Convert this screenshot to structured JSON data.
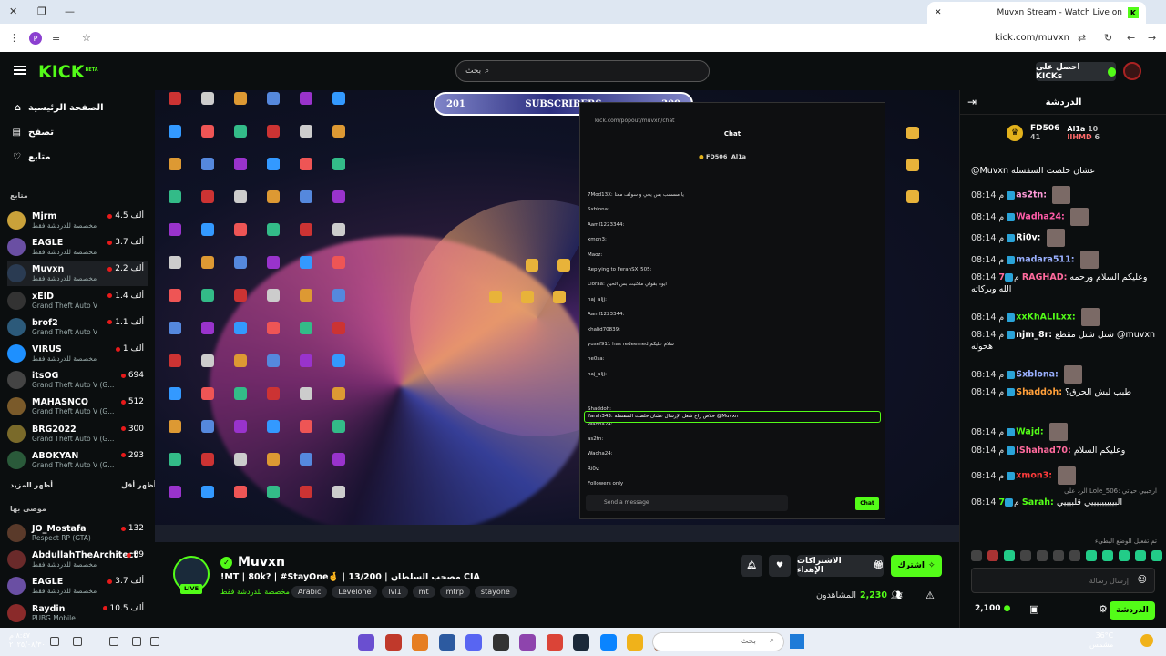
{
  "browser": {
    "tab_title": "Muvxn Stream - Watch Live on",
    "url": "kick.com/muvxn",
    "profile_initial": "P"
  },
  "header": {
    "search_placeholder": "بحث",
    "get_kicks": "احصل على KICKs"
  },
  "nav": [
    {
      "label": "الصفحة الرئيسية",
      "icon": "home-icon"
    },
    {
      "label": "تصفح",
      "icon": "browse-icon"
    },
    {
      "label": "متابع",
      "icon": "heart-icon"
    }
  ],
  "sidebar": {
    "following_title": "متابع",
    "following": [
      {
        "name": "Mjrm",
        "sub": "مخصصة للدردشة فقط",
        "count": "4.5 ألف",
        "color": "#c9a13a"
      },
      {
        "name": "EAGLE",
        "sub": "مخصصة للدردشة فقط",
        "count": "3.7 ألف",
        "color": "#6a4fa3"
      },
      {
        "name": "Muvxn",
        "sub": "مخصصة للدردشة فقط",
        "count": "2.2 ألف",
        "color": "#2a3b52"
      },
      {
        "name": "xEID",
        "sub": "Grand Theft Auto V",
        "count": "1.4 ألف",
        "color": "#333"
      },
      {
        "name": "brof2",
        "sub": "Grand Theft Auto V",
        "count": "1.1 ألف",
        "color": "#2c5a7a"
      },
      {
        "name": "VIRUS",
        "sub": "مخصصة للدردشة فقط",
        "count": "1 ألف",
        "color": "#1e90ff"
      },
      {
        "name": "itsOG",
        "sub": "Grand Theft Auto V (G...",
        "count": "694",
        "color": "#444"
      },
      {
        "name": "MAHASNCO",
        "sub": "Grand Theft Auto V (G...",
        "count": "512",
        "color": "#7a5a2a"
      },
      {
        "name": "BRG2022",
        "sub": "Grand Theft Auto V (G...",
        "count": "300",
        "color": "#7a6a2a"
      },
      {
        "name": "ABOKYAN",
        "sub": "Grand Theft Auto V (G...",
        "count": "293",
        "color": "#2a5a3a"
      }
    ],
    "show_more": "أظهر المزيد",
    "show_less": "أظهر أقل",
    "recommended_title": "موصى بها",
    "recommended": [
      {
        "name": "JO_Mostafa",
        "sub": "Respect RP (GTA)",
        "count": "132",
        "color": "#5a3a2a"
      },
      {
        "name": "AbdullahTheArchitect",
        "sub": "مخصصة للدردشة فقط",
        "count": "39",
        "color": "#6a2a2a"
      },
      {
        "name": "EAGLE",
        "sub": "مخصصة للدردشة فقط",
        "count": "3.7 ألف",
        "color": "#6a4fa3"
      },
      {
        "name": "Raydin",
        "sub": "PUBG Mobile",
        "count": "10.5 ألف",
        "color": "#8a2a2a"
      }
    ]
  },
  "overlay": {
    "sub_current": "201",
    "sub_label": "SUBSCRIBERS",
    "sub_goal": "300"
  },
  "popout": {
    "url": "kick.com/popout/muvxn/chat",
    "title": "Chat",
    "leader1": "FD506",
    "leader2": "Al1a",
    "highlight": "farah343: خلاص راح شغل الإرسال عشان خلصت السفسله @Muvxn",
    "input": "Send a message",
    "send": "Chat",
    "lines": [
      "7Mod13X: يا مسسب بس يجي و سولف معنا",
      "Sxblona:",
      "Aaml1223344:",
      "xmon3:",
      "Maoz:",
      "Replying to FerahSX_505:",
      "Lloraa: ايوه بقولي ماكنيت بس الحين",
      "haj_aljj:",
      "Aaml1223344:",
      "khalid70839:",
      "yusef911 has redeemed سلام عليكم",
      "ne0sa:",
      "haj_aljj:",
      "Shaddoh:",
      "Wadha24:",
      "as2tn:",
      "Wadha24:",
      "Ri0v:",
      "Followers only"
    ]
  },
  "chat": {
    "title": "الدردشة",
    "leaderboard": [
      {
        "name": "FD506",
        "value": "41"
      },
      {
        "name": "Al1a",
        "value": "10"
      },
      {
        "name": "IIHMD",
        "value": "6"
      }
    ],
    "messages": [
      {
        "time": "",
        "user": "",
        "color": "#ddd",
        "text": "@Muvxn عشان خلصت السفسله"
      },
      {
        "time": "08:14 م",
        "user": "as2tn:",
        "color": "#ff9ad8",
        "text": ""
      },
      {
        "time": "08:14 م",
        "user": "Wadha24:",
        "color": "#ff5ca8",
        "text": ""
      },
      {
        "time": "08:14 م",
        "user": "Ri0v:",
        "color": "#ffffff",
        "text": ""
      },
      {
        "time": "08:14 م",
        "user": "madara511:",
        "color": "#9ab0ff",
        "text": ""
      },
      {
        "time": "08:14 م",
        "user": "7RAGHAD:",
        "color": "#ff6a9d",
        "text": "وعليكم السلام ورحمه الله وبركاته"
      },
      {
        "time": "08:14 م",
        "user": "xxKhALILxx:",
        "color": "#53fc18",
        "text": ""
      },
      {
        "time": "08:14 م",
        "user": "njm_8r:",
        "color": "#ffffff",
        "text": "شتل شتل مقطع @muvxn هحوله"
      },
      {
        "time": "08:14 م",
        "user": "Sxblona:",
        "color": "#9ab0ff",
        "text": ""
      },
      {
        "time": "08:14 م",
        "user": "Shaddoh:",
        "color": "#ff9f3a",
        "text": "طيب ليش الحرق؟"
      },
      {
        "time": "08:14 م",
        "user": "Wajd:",
        "color": "#53fc18",
        "text": ""
      },
      {
        "time": "08:14 م",
        "user": "IShahad70:",
        "color": "#ff6a9d",
        "text": "وعليكم السلام"
      },
      {
        "time": "08:14 م",
        "user": "xmon3:",
        "color": "#ff3b3b",
        "text": ""
      },
      {
        "time": "08:14 م",
        "user": "7Sarah:",
        "color": "#53fc18",
        "text": "البيييييييييي قلبيييي"
      }
    ],
    "reply_note": "الرد على Lole_506: ارحبيي حياتي",
    "slow_note": "تم تفعيل الوضع البطيء",
    "input_placeholder": "إرسال رسالة",
    "points": "2,100",
    "send": "الدردشة"
  },
  "stream": {
    "name": "Muvxn",
    "live": "LIVE",
    "title": "!MT | 80k? | #StayOne🤞 | 13/200 | مصحب السلطان CIA",
    "category": "مخصصة للدردشة فقط",
    "tags": [
      "Arabic",
      "Levelone",
      "lvl1",
      "mt",
      "mtrp",
      "stayone"
    ],
    "subscribe": "اشترك",
    "gift": "الاشتراكات الإهداء",
    "viewers": "2,230",
    "viewers_label": "المشاهدون"
  },
  "taskbar": {
    "clock_time": "٨:٤٧ م",
    "clock_date": "٢٠٢٥/٠٨/٣٠",
    "search": "بحث",
    "weather_temp": "36°C",
    "weather_cond": "مشمس"
  }
}
